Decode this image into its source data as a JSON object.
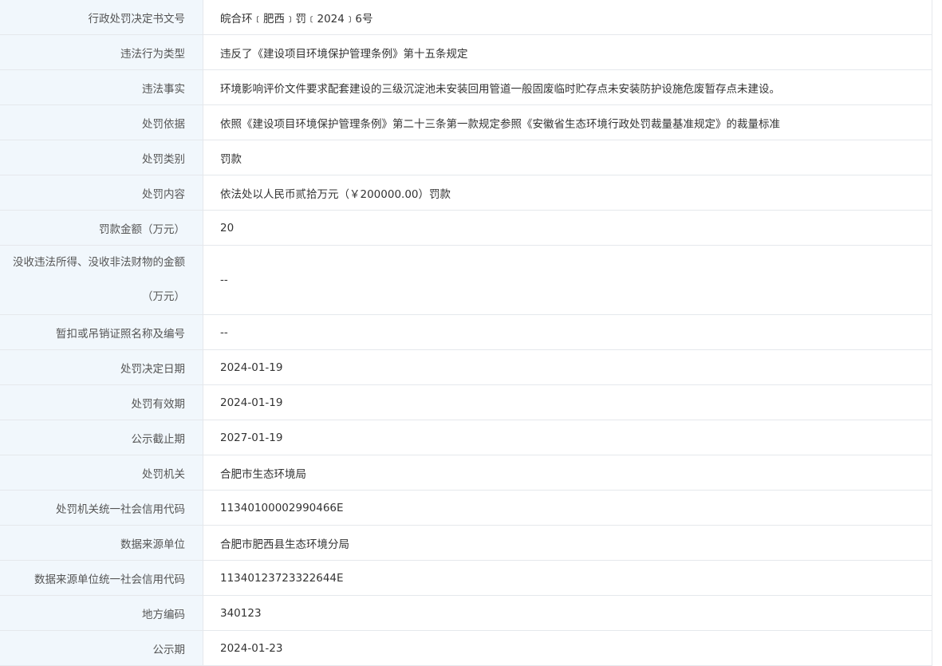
{
  "rows": [
    {
      "label": "行政处罚决定书文号",
      "value": "皖合环﹝肥西﹞罚﹝2024﹞6号"
    },
    {
      "label": "违法行为类型",
      "value": "违反了《建设项目环境保护管理条例》第十五条规定"
    },
    {
      "label": "违法事实",
      "value": "环境影响评价文件要求配套建设的三级沉淀池未安装回用管道一般固废临时贮存点未安装防护设施危废暂存点未建设。"
    },
    {
      "label": "处罚依据",
      "value": "依照《建设项目环境保护管理条例》第二十三条第一款规定参照《安徽省生态环境行政处罚裁量基准规定》的裁量标准"
    },
    {
      "label": "处罚类别",
      "value": "罚款"
    },
    {
      "label": "处罚内容",
      "value": "依法处以人民币贰拾万元（￥200000.00）罚款"
    },
    {
      "label": "罚款金额（万元）",
      "value": "20"
    },
    {
      "label": "没收违法所得、没收非法财物的金额（万元）",
      "value": "--"
    },
    {
      "label": "暂扣或吊销证照名称及编号",
      "value": "--"
    },
    {
      "label": "处罚决定日期",
      "value": "2024-01-19"
    },
    {
      "label": "处罚有效期",
      "value": "2024-01-19"
    },
    {
      "label": "公示截止期",
      "value": "2027-01-19"
    },
    {
      "label": "处罚机关",
      "value": "合肥市生态环境局"
    },
    {
      "label": "处罚机关统一社会信用代码",
      "value": "11340100002990466E"
    },
    {
      "label": "数据来源单位",
      "value": "合肥市肥西县生态环境分局"
    },
    {
      "label": "数据来源单位统一社会信用代码",
      "value": "11340123723322644E"
    },
    {
      "label": "地方编码",
      "value": "340123"
    },
    {
      "label": "公示期",
      "value": "2024-01-23"
    }
  ]
}
